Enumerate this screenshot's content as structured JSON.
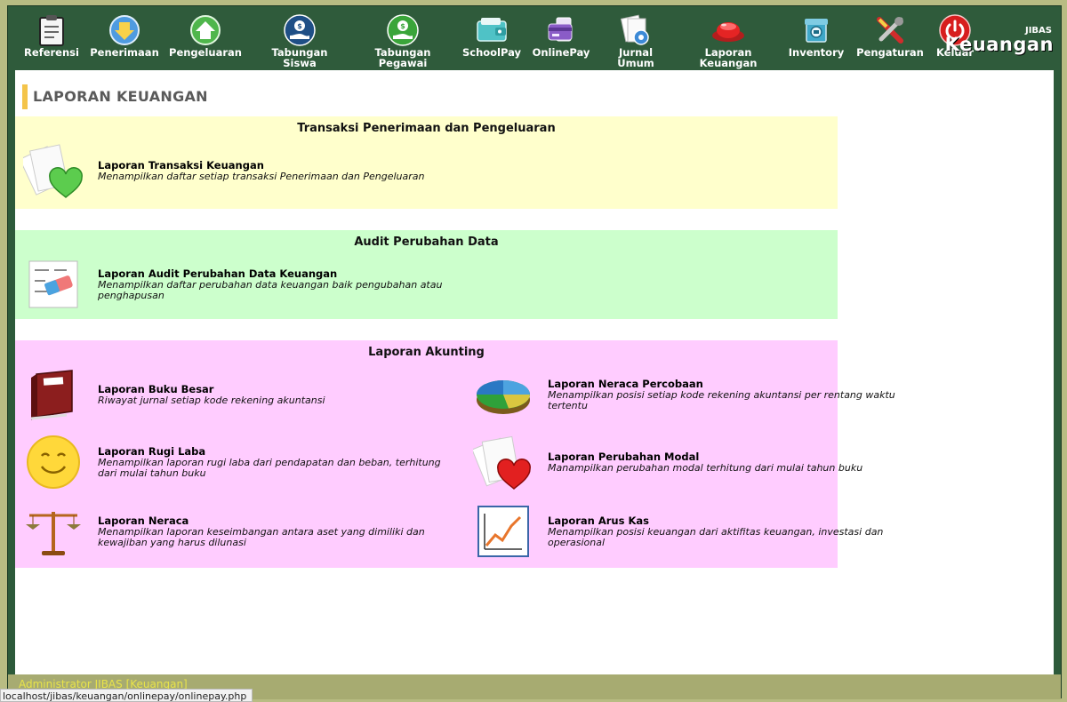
{
  "toolbar": {
    "items": [
      {
        "label": "Referensi",
        "icon": "clipboard-icon"
      },
      {
        "label": "Penerimaan",
        "icon": "arrow-down-icon"
      },
      {
        "label": "Pengeluaran",
        "icon": "arrow-up-icon"
      },
      {
        "label": "Tabungan\nSiswa",
        "icon": "savings-student-icon"
      },
      {
        "label": "Tabungan\nPegawai",
        "icon": "savings-employee-icon"
      },
      {
        "label": "SchoolPay",
        "icon": "wallet-icon"
      },
      {
        "label": "OnlinePay",
        "icon": "card-icon"
      },
      {
        "label": "Jurnal\nUmum",
        "icon": "journal-icon"
      },
      {
        "label": "Laporan\nKeuangan",
        "icon": "report-icon"
      },
      {
        "label": "Inventory",
        "icon": "inventory-icon"
      },
      {
        "label": "Pengaturan",
        "icon": "tools-icon"
      },
      {
        "label": "Keluar",
        "icon": "power-icon"
      }
    ],
    "brand_small": "JIBAS",
    "brand_big": "Keuangan"
  },
  "page": {
    "title": "LAPORAN KEUANGAN"
  },
  "sections": {
    "transaksi": {
      "title": "Transaksi Penerimaan dan Pengeluaran",
      "color": "#ffffcc",
      "items": [
        {
          "title": "Laporan Transaksi Keuangan",
          "desc": "Menampilkan daftar setiap transaksi Penerimaan dan Pengeluaran"
        }
      ]
    },
    "audit": {
      "title": "Audit Perubahan Data",
      "color": "#ccffcc",
      "items": [
        {
          "title": "Laporan Audit Perubahan Data Keuangan",
          "desc": "Menampilkan daftar perubahan data keuangan baik pengubahan atau penghapusan"
        }
      ]
    },
    "akunting": {
      "title": "Laporan Akunting",
      "color": "#ffccff",
      "items": [
        {
          "title": "Laporan Buku Besar",
          "desc": "Riwayat jurnal setiap kode rekening akuntansi"
        },
        {
          "title": "Laporan Neraca Percobaan",
          "desc": "Menampilkan posisi setiap kode rekening akuntansi per rentang waktu tertentu"
        },
        {
          "title": "Laporan Rugi Laba",
          "desc": "Menampilkan laporan rugi laba dari pendapatan dan beban, terhitung dari mulai tahun buku"
        },
        {
          "title": "Laporan Perubahan Modal",
          "desc": "Manampilkan perubahan modal terhitung dari mulai tahun buku"
        },
        {
          "title": "Laporan Neraca",
          "desc": "Menampilkan laporan keseimbangan antara aset yang dimiliki dan kewajiban yang harus dilunasi"
        },
        {
          "title": "Laporan Arus Kas",
          "desc": "Menampilkan posisi keuangan dari aktifitas keuangan, investasi dan operasional"
        }
      ]
    }
  },
  "footer": {
    "user": "Administrator JIBAS [Keuangan]"
  },
  "statusbar": {
    "url": "localhost/jibas/keuangan/onlinepay/onlinepay.php"
  }
}
